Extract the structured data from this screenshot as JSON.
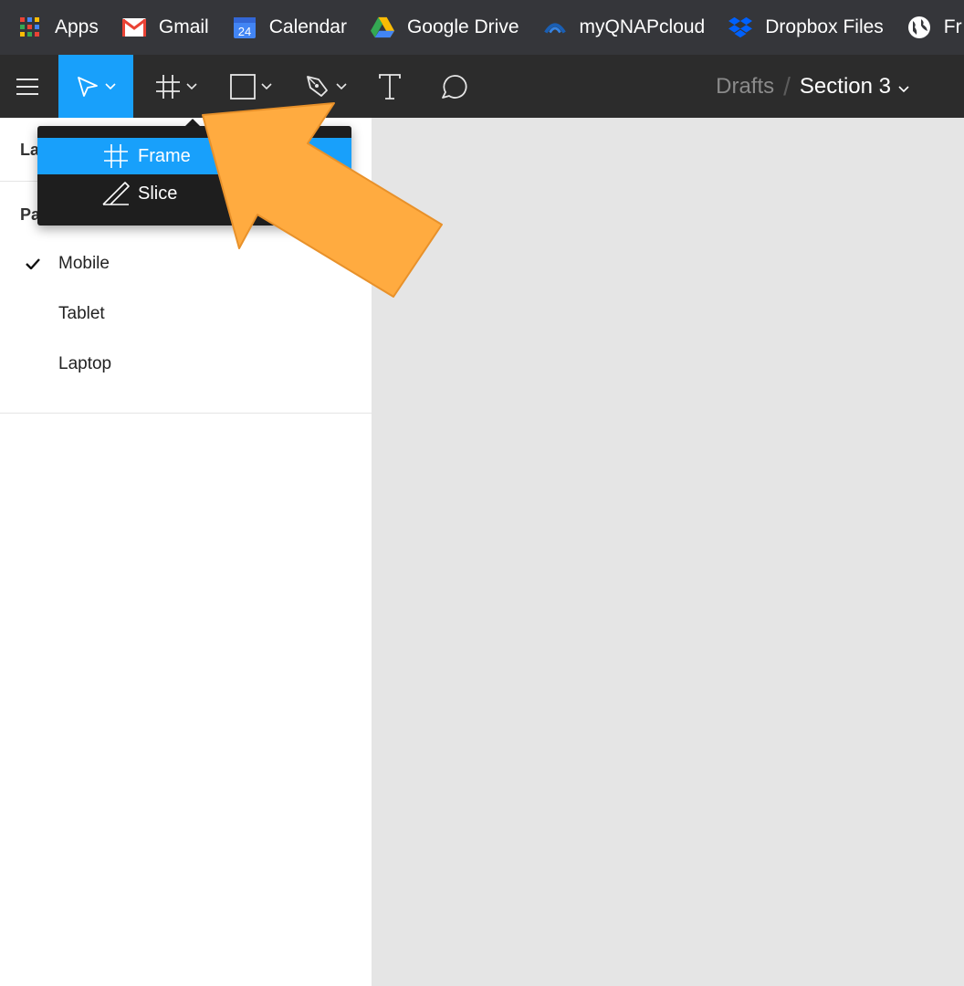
{
  "bookmarks": [
    {
      "label": "Apps",
      "icon": "apps-grid-icon"
    },
    {
      "label": "Gmail",
      "icon": "gmail-icon"
    },
    {
      "label": "Calendar",
      "icon": "calendar-icon",
      "badge": "24"
    },
    {
      "label": "Google Drive",
      "icon": "google-drive-icon"
    },
    {
      "label": "myQNAPcloud",
      "icon": "qnap-cloud-icon"
    },
    {
      "label": "Dropbox Files",
      "icon": "dropbox-icon"
    },
    {
      "label": "Fr",
      "icon": "globe-icon"
    }
  ],
  "toolbar": {
    "tools": [
      "menu-icon",
      "move-tool",
      "frame-tool",
      "shape-tool",
      "pen-tool",
      "text-tool",
      "comment-tool"
    ],
    "breadcrumb": {
      "parent": "Drafts",
      "separator": "/",
      "file": "Section 3"
    }
  },
  "left_panel": {
    "layers_heading": "La",
    "pages_heading": "Pa",
    "pages": [
      {
        "label": "Mobile",
        "selected": true
      },
      {
        "label": "Tablet",
        "selected": false
      },
      {
        "label": "Laptop",
        "selected": false
      }
    ]
  },
  "dropdown": {
    "items": [
      {
        "label": "Frame",
        "icon": "frame-icon",
        "active": true
      },
      {
        "label": "Slice",
        "icon": "slice-icon",
        "active": false
      }
    ]
  },
  "colors": {
    "accent": "#18a0fb",
    "toolbar": "#2c2c2c",
    "bookmarks_bar": "#35363a",
    "annotation_arrow": "#ffab40",
    "canvas": "#e5e5e5"
  }
}
